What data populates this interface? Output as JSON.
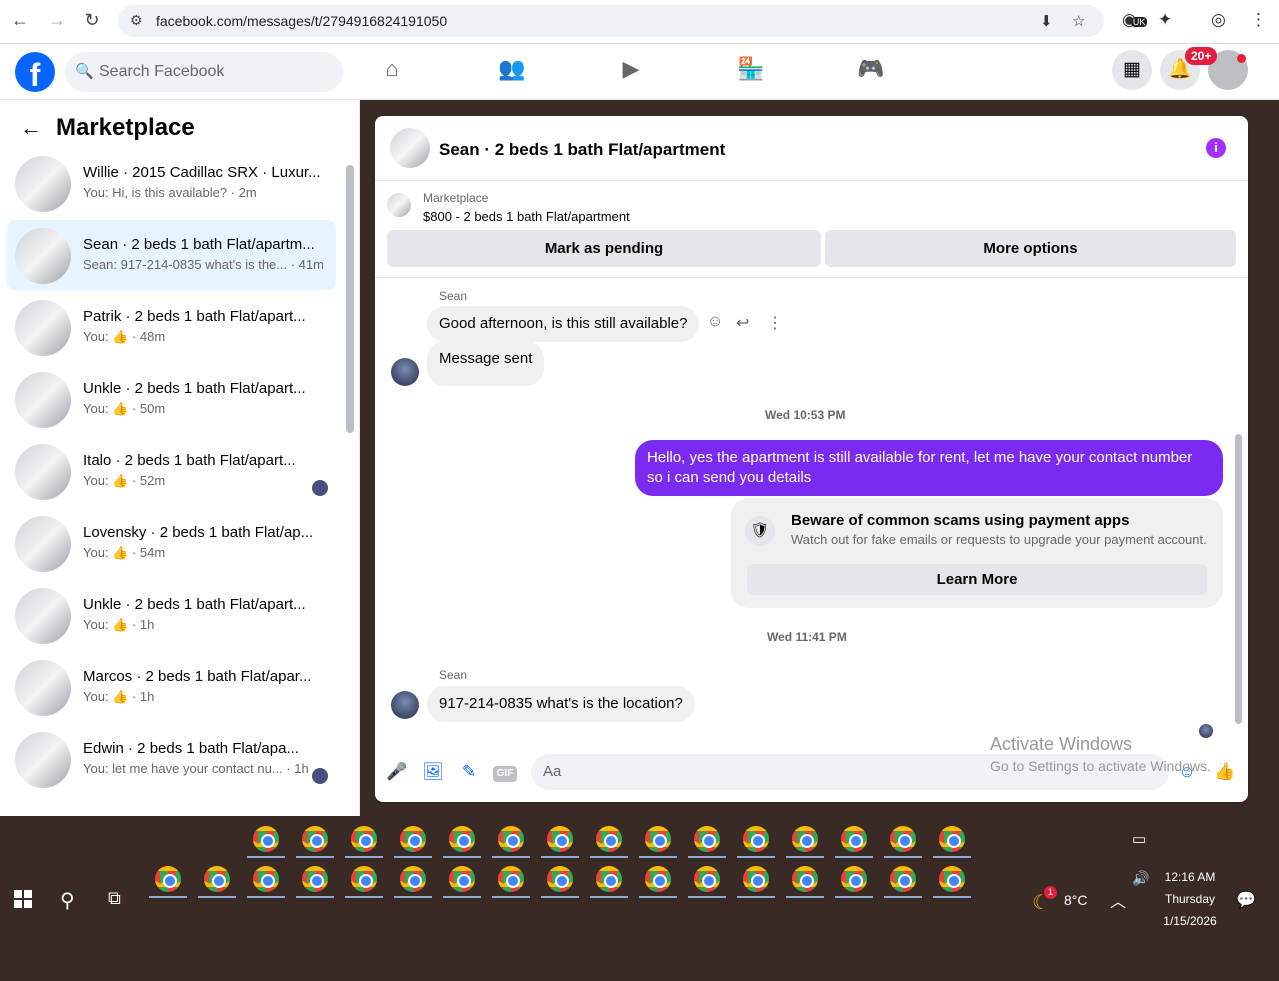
{
  "browser": {
    "url": "facebook.com/messages/t/2794916824191050",
    "ext_badge": "UK"
  },
  "facebook": {
    "search_placeholder": "Search Facebook",
    "notif_badge": "20+"
  },
  "sidebar": {
    "title": "Marketplace",
    "conversations": [
      {
        "name": "Willie · 2015 Cadillac SRX · Luxur...",
        "preview": "You: Hi, is this available? · 2m",
        "active": false
      },
      {
        "name": "Sean · 2 beds 1 bath Flat/apartm...",
        "preview": "Sean: 917-214-0835 what's is the... · 41m",
        "active": true
      },
      {
        "name": "Patrik · 2 beds 1 bath Flat/apart...",
        "preview": "You: 👍 · 48m",
        "active": false
      },
      {
        "name": "Unkle · 2 beds 1 bath Flat/apart...",
        "preview": "You: 👍 · 50m",
        "active": false
      },
      {
        "name": "Italo · 2 beds 1 bath Flat/apart...",
        "preview": "You: 👍 · 52m",
        "active": false
      },
      {
        "name": "Lovensky · 2 beds 1 bath Flat/ap...",
        "preview": "You: 👍 · 54m",
        "active": false
      },
      {
        "name": "Unkle · 2 beds 1 bath Flat/apart...",
        "preview": "You: 👍 · 1h",
        "active": false
      },
      {
        "name": "Marcos · 2 beds 1 bath Flat/apar...",
        "preview": "You: 👍 · 1h",
        "active": false
      },
      {
        "name": "Edwin · 2 beds 1 bath Flat/apa...",
        "preview": "You: let me have your contact nu... · 1h",
        "active": false
      }
    ]
  },
  "chat": {
    "title": "Sean · 2 beds 1 bath Flat/apartment",
    "marketplace_label": "Marketplace",
    "listing": "$800 - 2 beds 1 bath Flat/apartment",
    "mark_pending": "Mark as pending",
    "more_options": "More options",
    "sender1": "Sean",
    "msg1": "Good afternoon, is this still available?",
    "msg2": "Message sent",
    "ts1": "Wed 10:53 PM",
    "msg3": "Hello, yes the apartment is still available for rent, let me have your contact number so i can send you details",
    "scam_title": "Beware of common scams using payment apps",
    "scam_desc": "Watch out for fake emails or requests to upgrade your payment account.",
    "learn_more": "Learn More",
    "ts2": "Wed 11:41 PM",
    "sender2": "Sean",
    "msg4": "917-214-0835 what's is the location?",
    "input_placeholder": "Aa",
    "gif_label": "GIF"
  },
  "windows": {
    "activate_title": "Activate Windows",
    "activate_sub": "Go to Settings to activate Windows.",
    "temp": "8°C",
    "weather_badge": "1",
    "time": "12:16 AM",
    "day": "Thursday",
    "date": "1/15/2026"
  }
}
